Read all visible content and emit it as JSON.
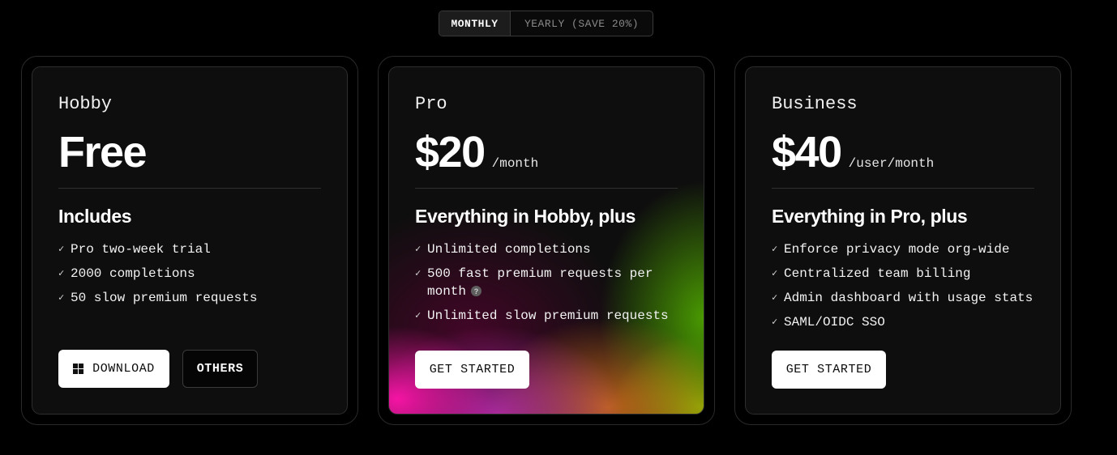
{
  "billing_toggle": {
    "monthly_label": "MONTHLY",
    "yearly_label": "YEARLY (SAVE 20%)",
    "selected": "monthly"
  },
  "plans": [
    {
      "tier": "Hobby",
      "price": "Free",
      "period": "",
      "heading": "Includes",
      "features": [
        "Pro two-week trial",
        "2000 completions",
        "50 slow premium requests"
      ],
      "buttons": {
        "primary": "DOWNLOAD",
        "primary_icon": "windows-icon",
        "secondary": "OTHERS"
      }
    },
    {
      "tier": "Pro",
      "price": "$20",
      "period": "/month",
      "heading": "Everything in Hobby, plus",
      "features": [
        "Unlimited completions",
        "500 fast premium requests per month",
        "Unlimited slow premium requests"
      ],
      "help_icon": "?",
      "buttons": {
        "primary": "GET STARTED"
      }
    },
    {
      "tier": "Business",
      "price": "$40",
      "period": "/user/month",
      "heading": "Everything in Pro, plus",
      "features": [
        "Enforce privacy mode org-wide",
        "Centralized team billing",
        "Admin dashboard with usage stats",
        "SAML/OIDC SSO"
      ],
      "buttons": {
        "primary": "GET STARTED"
      }
    }
  ],
  "colors": {
    "background": "#000000",
    "card": "#0e0e0e",
    "button_primary": "#ffffff",
    "gradient": [
      "#ff14aa",
      "#d232c8",
      "#e6781e",
      "#50aa00",
      "#aabe00"
    ]
  },
  "check_glyph": "✓"
}
